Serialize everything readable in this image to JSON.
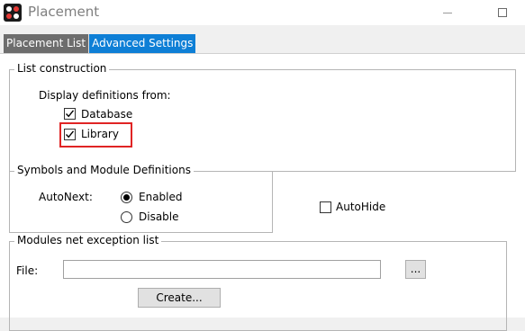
{
  "window": {
    "title": "Placement",
    "icon": "placement-app-icon"
  },
  "tabs": [
    {
      "label": "Placement List",
      "active": false
    },
    {
      "label": "Advanced Settings",
      "active": true
    }
  ],
  "list_construction": {
    "legend": "List construction",
    "display_label": "Display definitions from:",
    "options": [
      {
        "label": "Database",
        "checked": true
      },
      {
        "label": "Library",
        "checked": true
      }
    ]
  },
  "symbols": {
    "legend": "Symbols and Module Definitions",
    "autonext_label": "AutoNext:",
    "options": [
      {
        "label": "Enabled",
        "selected": true
      },
      {
        "label": "Disable",
        "selected": false
      }
    ]
  },
  "autohide": {
    "label": "AutoHide",
    "checked": false
  },
  "modules": {
    "legend": "Modules net exception list",
    "file_label": "File:",
    "file_value": "",
    "browse_label": "...",
    "create_label": "Create..."
  },
  "colors": {
    "active_tab": "#0e7fd6",
    "inactive_tab": "#6d6d6d",
    "highlight": "#e02424"
  }
}
